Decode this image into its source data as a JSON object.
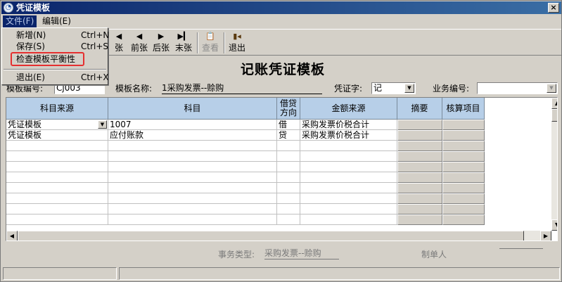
{
  "window": {
    "title": "凭证模板",
    "close_glyph": "×"
  },
  "menu": {
    "file": "文件(F)",
    "edit": "编辑(E)"
  },
  "file_menu": {
    "items": [
      {
        "label": "新增(N)",
        "shortcut": "Ctrl+N"
      },
      {
        "label": "保存(S)",
        "shortcut": "Ctrl+S"
      },
      {
        "label": "检查模板平衡性",
        "shortcut": ""
      },
      {
        "label": "退出(E)",
        "shortcut": "Ctrl+X"
      }
    ],
    "highlight_color": "#e53030"
  },
  "toolbar": {
    "first_partial": "张",
    "prev": "前张",
    "next": "后张",
    "last": "末张",
    "view": "查看",
    "exit": "退出"
  },
  "header": {
    "title": "记账凭证模板",
    "template_no_label": "模板编号:",
    "template_no_value": "Cj003",
    "template_name_label": "模板名称:",
    "template_name_value": "1采购发票--赊购",
    "voucher_word_label": "凭证字:",
    "voucher_word_value": "记",
    "business_no_label": "业务编号:",
    "business_no_value": ""
  },
  "grid": {
    "columns": [
      "科目来源",
      "科目",
      "借贷方向",
      "金额来源",
      "摘要",
      "核算项目"
    ],
    "direction_col_lines": [
      "借贷",
      "方向"
    ],
    "rows": [
      {
        "source": "凭证模板",
        "account": "1007",
        "direction": "借",
        "amount_source": "采购发票价税合计"
      },
      {
        "source": "凭证模板",
        "account": "应付账款",
        "direction": "贷",
        "amount_source": "采购发票价税合计"
      }
    ],
    "header_color": "#b7cfe8"
  },
  "footer": {
    "business_type_label": "事务类型:",
    "business_type_value": "采购发票--赊购",
    "creator_label": "制单人"
  }
}
